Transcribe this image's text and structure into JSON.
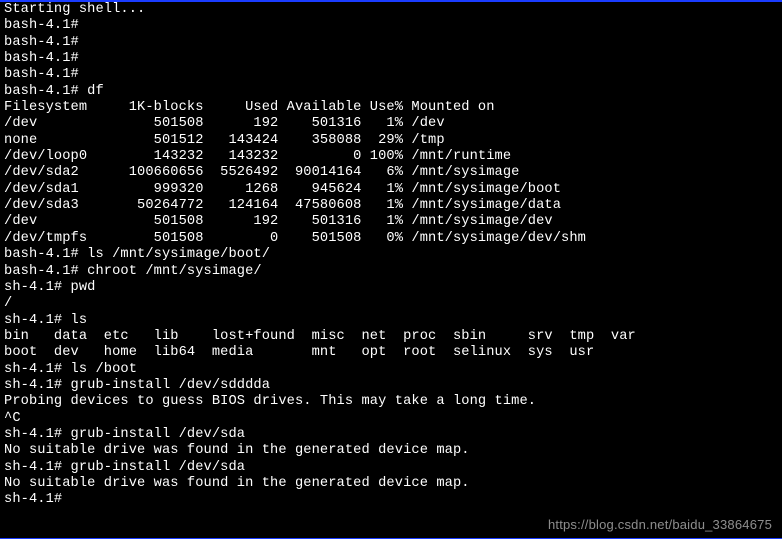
{
  "lines": [
    "Starting shell...",
    "bash-4.1#",
    "bash-4.1#",
    "bash-4.1#",
    "bash-4.1#",
    "bash-4.1# df"
  ],
  "df": {
    "header": {
      "fs": "Filesystem",
      "blocks": "1K-blocks",
      "used": "Used",
      "avail": "Available",
      "usep": "Use%",
      "mount": "Mounted on"
    },
    "rows": [
      {
        "fs": "/dev",
        "blocks": "501508",
        "used": "192",
        "avail": "501316",
        "usep": "1%",
        "mount": "/dev"
      },
      {
        "fs": "none",
        "blocks": "501512",
        "used": "143424",
        "avail": "358088",
        "usep": "29%",
        "mount": "/tmp"
      },
      {
        "fs": "/dev/loop0",
        "blocks": "143232",
        "used": "143232",
        "avail": "0",
        "usep": "100%",
        "mount": "/mnt/runtime"
      },
      {
        "fs": "/dev/sda2",
        "blocks": "100660656",
        "used": "5526492",
        "avail": "90014164",
        "usep": "6%",
        "mount": "/mnt/sysimage"
      },
      {
        "fs": "/dev/sda1",
        "blocks": "999320",
        "used": "1268",
        "avail": "945624",
        "usep": "1%",
        "mount": "/mnt/sysimage/boot"
      },
      {
        "fs": "/dev/sda3",
        "blocks": "50264772",
        "used": "124164",
        "avail": "47580608",
        "usep": "1%",
        "mount": "/mnt/sysimage/data"
      },
      {
        "fs": "/dev",
        "blocks": "501508",
        "used": "192",
        "avail": "501316",
        "usep": "1%",
        "mount": "/mnt/sysimage/dev"
      },
      {
        "fs": "/dev/tmpfs",
        "blocks": "501508",
        "used": "0",
        "avail": "501508",
        "usep": "0%",
        "mount": "/mnt/sysimage/dev/shm"
      }
    ]
  },
  "after_df": [
    "bash-4.1# ls /mnt/sysimage/boot/",
    "bash-4.1# chroot /mnt/sysimage/",
    "sh-4.1# pwd",
    "/",
    "sh-4.1# ls"
  ],
  "ls1": "bin   data  etc   lib    lost+found  misc  net  proc  sbin     srv  tmp  var",
  "ls2": "boot  dev   home  lib64  media       mnt   opt  root  selinux  sys  usr",
  "after_ls": [
    "sh-4.1# ls /boot",
    "sh-4.1# grub-install /dev/sdddda",
    "Probing devices to guess BIOS drives. This may take a long time.",
    "^C",
    "sh-4.1# grub-install /dev/sda",
    "No suitable drive was found in the generated device map.",
    "sh-4.1# grub-install /dev/sda",
    "No suitable drive was found in the generated device map.",
    "sh-4.1#"
  ],
  "watermark": "https://blog.csdn.net/baidu_33864675"
}
